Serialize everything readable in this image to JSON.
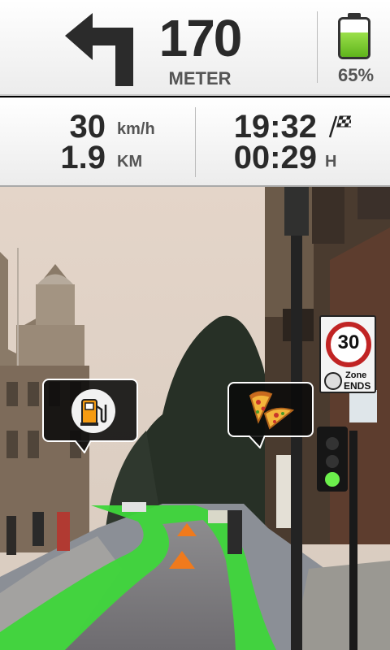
{
  "maneuver": {
    "icon": "turn-left-icon",
    "distance": "170",
    "distance_unit": "METER"
  },
  "battery": {
    "icon": "battery-icon",
    "percent_label": "65%",
    "level": 0.65,
    "fill_color": "#7fcc2e"
  },
  "trip": {
    "speed": "30",
    "speed_unit": "km/h",
    "remaining_distance": "1.9",
    "remaining_distance_unit": "KM",
    "arrival_time": "19:32",
    "arrival_icon": "checkered-flag-icon",
    "remaining_time": "00:29",
    "remaining_time_unit": "H"
  },
  "poi_markers": [
    {
      "name": "gas-station",
      "icon": "gas-pump-icon"
    },
    {
      "name": "pizza",
      "icon": "pizza-icon"
    }
  ],
  "road_sign": {
    "speed_limit": "30",
    "zone_label": "Zone",
    "ends_label": "ENDS"
  },
  "route": {
    "color": "#3ed63a",
    "direction_marker_color": "#f07a1c"
  }
}
